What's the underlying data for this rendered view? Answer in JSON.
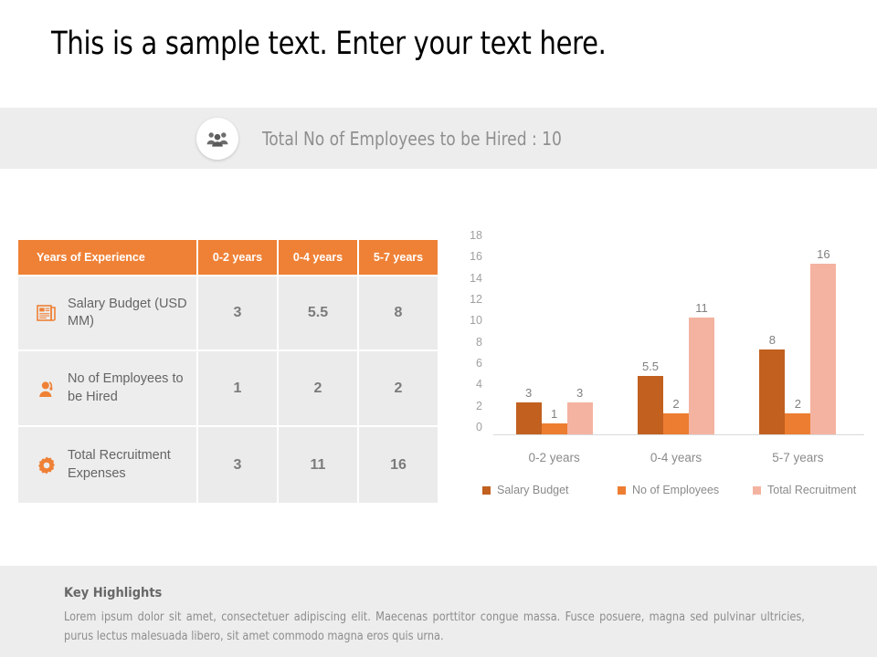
{
  "page_title": "This is a sample text. Enter your text here.",
  "banner": {
    "icon": "people-group-icon",
    "text": "Total No of Employees to be Hired : 10"
  },
  "table": {
    "headers": [
      "Years of Experience",
      "0-2 years",
      "0-4 years",
      "5-7 years"
    ],
    "rows": [
      {
        "icon": "newspaper-icon",
        "label": "Salary Budget (USD MM)",
        "values": [
          "3",
          "5.5",
          "8"
        ]
      },
      {
        "icon": "support-agent-icon",
        "label": "No of Employees to be Hired",
        "values": [
          "1",
          "2",
          "2"
        ]
      },
      {
        "icon": "gear-icon",
        "label": "Total Recruitment Expenses",
        "values": [
          "3",
          "11",
          "16"
        ]
      }
    ]
  },
  "chart_data": {
    "type": "bar",
    "title": "",
    "xlabel": "",
    "ylabel": "",
    "categories": [
      "0-2 years",
      "0-4 years",
      "5-7 years"
    ],
    "series": [
      {
        "name": "Salary Budget",
        "values": [
          3,
          5.5,
          8
        ],
        "color": "#c1601f"
      },
      {
        "name": "No of Employees",
        "values": [
          1,
          2,
          2
        ],
        "color": "#ed7d31"
      },
      {
        "name": "Total Recruitment",
        "values": [
          3,
          11,
          16
        ],
        "color": "#f4b3a0"
      }
    ],
    "data_labels": [
      [
        "3",
        "5.5",
        "8"
      ],
      [
        "1",
        "2",
        "2"
      ],
      [
        "3",
        "11",
        "16"
      ]
    ],
    "yticks": [
      18,
      16,
      14,
      12,
      10,
      8,
      6,
      4,
      2,
      0
    ],
    "ylim": [
      0,
      18
    ],
    "grid": false,
    "legend_position": "bottom"
  },
  "key_highlights": {
    "title": "Key Highlights",
    "body": "Lorem ipsum dolor sit amet, consectetuer adipiscing elit. Maecenas porttitor congue massa. Fusce posuere, magna sed pulvinar ultricies, purus lectus malesuada libero, sit amet commodo magna eros quis urna."
  },
  "colors": {
    "accent": "#ef8136",
    "banner_bg": "#ededed",
    "cell_bg": "#ebebeb"
  }
}
